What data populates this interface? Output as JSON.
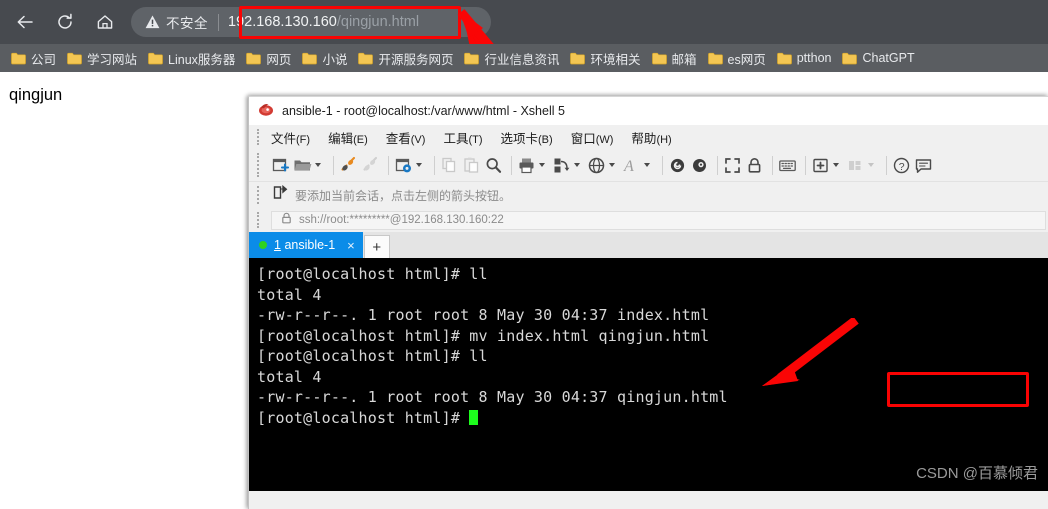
{
  "browser": {
    "nav": {
      "back_icon": "arrow-left-icon",
      "reload_icon": "reload-icon",
      "home_icon": "home-icon"
    },
    "omnibox": {
      "security_icon": "warning-triangle-icon",
      "security_label": "不安全",
      "url_host": "192.168.130.160",
      "url_path": "/qingjun.html",
      "url_full": "192.168.130.160/qingjun.html"
    },
    "bookmarks": [
      {
        "label": "公司",
        "icon": "folder-icon"
      },
      {
        "label": "学习网站",
        "icon": "folder-icon"
      },
      {
        "label": "Linux服务器",
        "icon": "folder-icon"
      },
      {
        "label": "网页",
        "icon": "folder-icon"
      },
      {
        "label": "小说",
        "icon": "folder-icon"
      },
      {
        "label": "开源服务网页",
        "icon": "folder-icon"
      },
      {
        "label": "行业信息资讯",
        "icon": "folder-icon"
      },
      {
        "label": "环境相关",
        "icon": "folder-icon"
      },
      {
        "label": "邮箱",
        "icon": "folder-icon"
      },
      {
        "label": "es网页",
        "icon": "folder-icon"
      },
      {
        "label": "ptthon",
        "icon": "folder-icon"
      },
      {
        "label": "ChatGPT",
        "icon": "folder-icon"
      }
    ],
    "page_body_text": "qingjun"
  },
  "xshell": {
    "title": "ansible-1 - root@localhost:/var/www/html - Xshell 5",
    "app_icon": "xshell-logo-icon",
    "menu": [
      {
        "label": "文件",
        "mnemonic": "(F)"
      },
      {
        "label": "编辑",
        "mnemonic": "(E)"
      },
      {
        "label": "查看",
        "mnemonic": "(V)"
      },
      {
        "label": "工具",
        "mnemonic": "(T)"
      },
      {
        "label": "选项卡",
        "mnemonic": "(B)"
      },
      {
        "label": "窗口",
        "mnemonic": "(W)"
      },
      {
        "label": "帮助",
        "mnemonic": "(H)"
      }
    ],
    "notice": {
      "icon": "add-session-arrow-icon",
      "text": "要添加当前会话，点击左侧的箭头按钮。"
    },
    "address": {
      "icon": "lock-icon",
      "value": "ssh://root:*********@192.168.130.160:22"
    },
    "tabs": [
      {
        "index": "1",
        "label": "ansible-1",
        "status": "connected",
        "close_icon": "close-icon"
      }
    ],
    "new_tab_label": "+",
    "terminal": {
      "lines": [
        "[root@localhost html]# ll",
        "total 4",
        "-rw-r--r--. 1 root root 8 May 30 04:37 index.html",
        "[root@localhost html]# mv index.html qingjun.html",
        "[root@localhost html]# ll",
        "total 4",
        "-rw-r--r--. 1 root root 8 May 30 04:37 qingjun.html",
        "[root@localhost html]# "
      ],
      "cursor": "block"
    },
    "watermark": "CSDN @百慕倾君"
  },
  "annotations": {
    "highlight_color": "#f90303",
    "arrow_color": "#fa0505",
    "url_box_target": "192.168.130.160/qingjun.html",
    "terminal_box_target": "qingjun.html"
  }
}
